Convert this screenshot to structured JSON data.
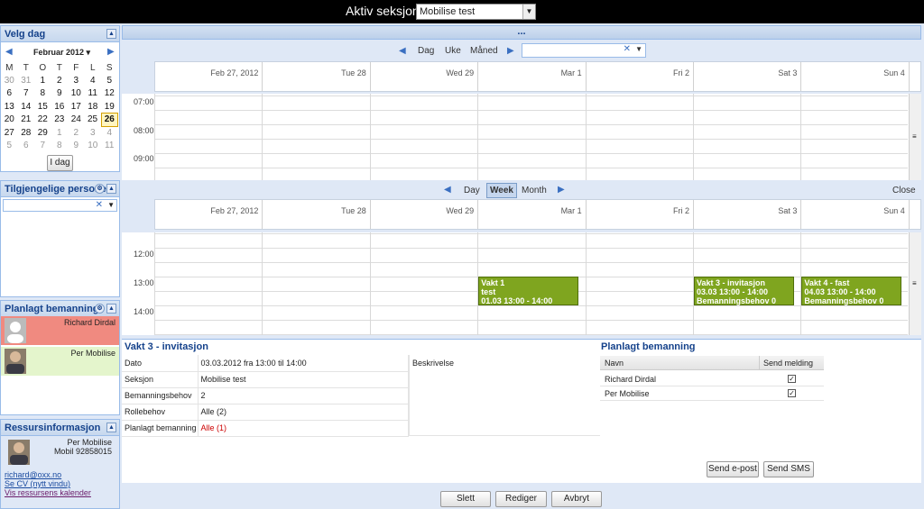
{
  "topbar": {
    "label": "Aktiv seksjon:",
    "section_value": "Mobilise test"
  },
  "left": {
    "velg_dag": {
      "title": "Velg dag",
      "month_label": "Februar 2012",
      "dow": [
        "M",
        "T",
        "O",
        "T",
        "F",
        "L",
        "S"
      ],
      "weeks": [
        [
          "30",
          "31",
          "1",
          "2",
          "3",
          "4",
          "5"
        ],
        [
          "6",
          "7",
          "8",
          "9",
          "10",
          "11",
          "12"
        ],
        [
          "13",
          "14",
          "15",
          "16",
          "17",
          "18",
          "19"
        ],
        [
          "20",
          "21",
          "22",
          "23",
          "24",
          "25",
          "26"
        ],
        [
          "27",
          "28",
          "29",
          "1",
          "2",
          "3",
          "4"
        ],
        [
          "5",
          "6",
          "7",
          "8",
          "9",
          "10",
          "11"
        ]
      ],
      "today_button": "I dag"
    },
    "personer": {
      "title": "Tilgjengelige personer",
      "search_value": ""
    },
    "planlagt": {
      "title": "Planlagt bemanning",
      "people": [
        "Richard Dirdal",
        "Per Mobilise"
      ]
    },
    "ressurs": {
      "title": "Ressursinformasjon",
      "name": "Per Mobilise",
      "mobile": "Mobil 92858015",
      "email": "richard@oxx.no",
      "cv_link": "Se CV (nytt vindu)",
      "calendar_link": "Vis ressursens kalender"
    }
  },
  "collapse_dots": "...",
  "cal1": {
    "nav": {
      "day": "Dag",
      "week": "Uke",
      "month": "Måned"
    },
    "days": [
      "Feb 27, 2012",
      "Tue 28",
      "Wed 29",
      "Mar 1",
      "Fri 2",
      "Sat 3",
      "Sun 4"
    ],
    "times": [
      "07:00",
      "08:00",
      "09:00"
    ]
  },
  "cal2": {
    "nav": {
      "day": "Day",
      "week": "Week",
      "month": "Month",
      "close": "Close"
    },
    "days": [
      "Feb 27, 2012",
      "Tue 28",
      "Wed 29",
      "Mar 1",
      "Fri 2",
      "Sat 3",
      "Sun 4"
    ],
    "times": [
      "12:00",
      "13:00",
      "14:00"
    ],
    "events": [
      {
        "title": "Vakt 1",
        "line2": "test",
        "line3": "01.03 13:00 - 14:00"
      },
      {
        "title": "Vakt 3 - invitasjon",
        "line2": "03.03 13:00 - 14:00",
        "line3": "Bemanningsbehov 0"
      },
      {
        "title": "Vakt 4 - fast",
        "line2": "04.03 13:00 - 14:00",
        "line3": "Bemanningsbehov 0"
      }
    ]
  },
  "details": {
    "title": "Vakt 3 - invitasjon",
    "rows": [
      {
        "label": "Dato",
        "value": "03.03.2012 fra 13:00 til 14:00"
      },
      {
        "label": "Seksjon",
        "value": "Mobilise test"
      },
      {
        "label": "Bemanningsbehov",
        "value": "2"
      },
      {
        "label": "Rollebehov",
        "value": "Alle (2)"
      },
      {
        "label": "Planlagt bemanning",
        "value": "Alle (1)"
      }
    ],
    "beskrivelse_label": "Beskrivelse"
  },
  "planlagt_table": {
    "title": "Planlagt bemanning",
    "col_name": "Navn",
    "col_send": "Send melding",
    "rows": [
      {
        "name": "Richard Dirdal"
      },
      {
        "name": "Per Mobilise"
      }
    ],
    "send_email": "Send e-post",
    "send_sms": "Send SMS"
  },
  "bottom": {
    "delete": "Slett",
    "edit": "Rediger",
    "cancel": "Avbryt"
  }
}
